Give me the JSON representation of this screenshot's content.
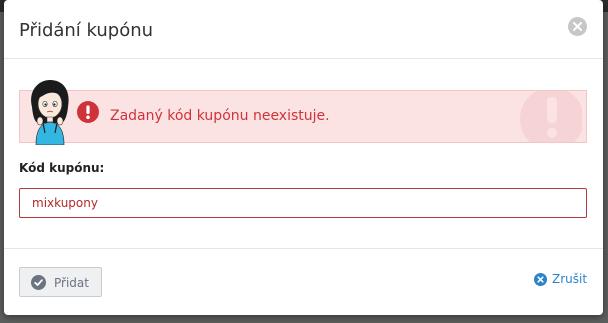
{
  "dialog": {
    "title": "Přidání kupónu",
    "close_icon": "close-icon"
  },
  "alert": {
    "message": "Zadaný kód kupónu neexistuje.",
    "icon": "exclamation-circle-icon",
    "color": "#d0323a",
    "background": "#fbe3e4"
  },
  "form": {
    "coupon_label": "Kód kupónu:",
    "coupon_value": "mixkupony"
  },
  "footer": {
    "submit_label": "Přidat",
    "submit_icon": "check-circle-icon",
    "cancel_label": "Zrušit",
    "cancel_icon": "x-circle-icon",
    "link_color": "#2a84c8"
  }
}
